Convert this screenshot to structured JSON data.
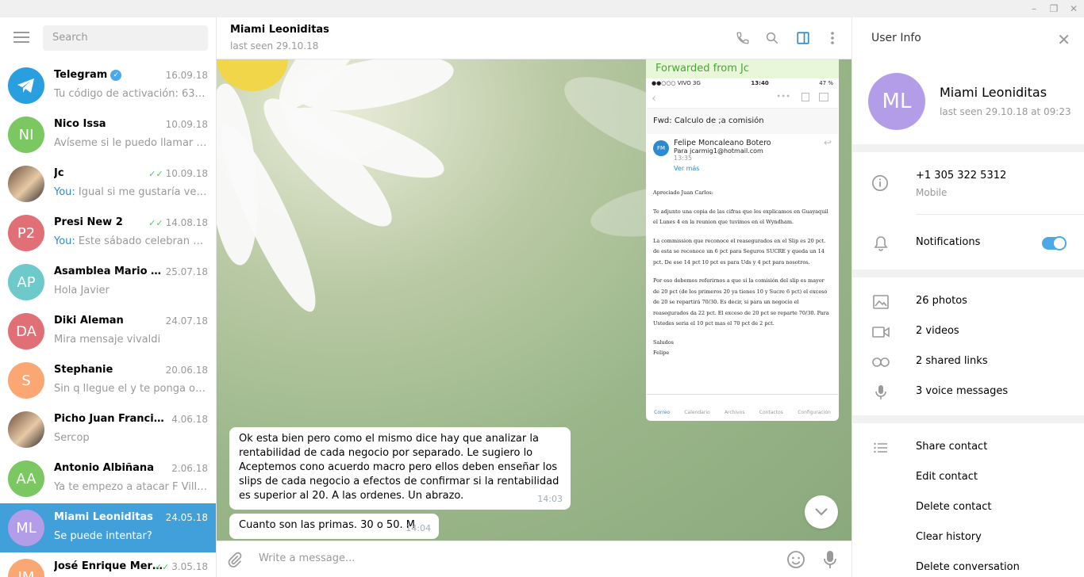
{
  "window": {
    "minimize_icon": "minimize-icon",
    "restore_icon": "restore-icon",
    "close_icon": "close-icon"
  },
  "sidebar": {
    "search_placeholder": "Search",
    "chats": [
      {
        "name": "Telegram",
        "verified": true,
        "date": "16.09.18",
        "preview": "Tu código de activación: 63664 ...",
        "avatar_color": "#2a9fe0",
        "avatar_text": ""
      },
      {
        "name": "Nico Issa",
        "date": "10.09.18",
        "preview": "Avíseme si le puedo llamar por ...",
        "avatar_color": "#7bc862",
        "avatar_text": "NI"
      },
      {
        "name": "Jc",
        "date": "10.09.18",
        "ticks": "✓✓",
        "you": "You:",
        "preview": " Igual si me gustaría verlo s...",
        "avatar_color": "#3a3a3a",
        "avatar_text": ""
      },
      {
        "name": "Presi New 2",
        "date": "14.08.18",
        "ticks": "✓✓",
        "you": "You:",
        "preview": " Este sábado celebran 4 a...",
        "avatar_color": "#e17076",
        "avatar_text": "P2"
      },
      {
        "name": "Asamblea Mario Paz...",
        "date": "25.07.18",
        "preview": "Hola Javier",
        "avatar_color": "#6ec9cb",
        "avatar_text": "AP"
      },
      {
        "name": "Diki Aleman",
        "date": "24.07.18",
        "preview": "Mira mensaje vivaldi",
        "avatar_color": "#e17076",
        "avatar_text": "DA"
      },
      {
        "name": "Stephanie",
        "date": "20.06.18",
        "preview": "Sin q llegue el y te ponga obstá...",
        "avatar_color": "#faa774",
        "avatar_text": "S"
      },
      {
        "name": "Picho Juan Francisco",
        "date": "4.06.18",
        "preview": "Sercop",
        "avatar_color": "#c62828",
        "avatar_text": ""
      },
      {
        "name": "Antonio Albiñana",
        "date": "2.06.18",
        "preview": "Ya te empezo a atacar F Vill con...",
        "avatar_color": "#7bc862",
        "avatar_text": "AA"
      },
      {
        "name": "Miami Leoniditas",
        "date": "24.05.18",
        "preview": "Se puede intentar?",
        "avatar_color": "#b39ce8",
        "avatar_text": "ML",
        "active": true
      },
      {
        "name": "José Enrique Merc...",
        "date": "3.05.18",
        "ticks": "✓✓",
        "preview": "",
        "avatar_color": "#faa774",
        "avatar_text": "JM"
      }
    ]
  },
  "chat": {
    "peer_name": "Miami Leoniditas",
    "peer_status": "last seen 29.10.18",
    "forwarded_label": "Forwarded from Jc",
    "phone": {
      "carrier": "●●○○○ VIVO  3G",
      "time": "13:40",
      "battery": "47 %",
      "subject": "Fwd: Calculo de ;a comisión",
      "fm": "FM",
      "sender": "Felipe Moncaleano Botero",
      "to": "Para jcarmig1@hotmail.com",
      "sent_time": "13:35",
      "ver_mas": "Ver más",
      "body": [
        "Apreciado Juan Carlos:",
        "Te adjunto una copia de las cifras que les explicamos en Guayaquil el Lunes 4 en la reunion que tuvimos en el Wyndham.",
        "La commission que reconoce el reasegurados en el Slip es 20 pct. de esta se reconoce un 6 pct para Seguros SUCRE y queda un 14 pct. De ese 14 pct 10 pct es para Uds y 4 pct para nosotros.",
        "Por eso debemos referirnos a que si la comisión del slip es mayor de 20 pct (de los primeros 20 ya tienes 10 y Sucre 6 pct) el exceso de 20 se repartirá 70/30. Es decir, si para un negocio el reasegurados da 22 pct. El exceso de 20 pct se reparte 70/30. Para Ustedes seria el 10 pct mas el 70 pct de 2 pct.",
        "Saludos",
        "Felipe"
      ],
      "tabs": [
        "Correo",
        "Calendario",
        "Archivos",
        "Contactos",
        "Configuración"
      ]
    },
    "messages": [
      {
        "text": "Ok esta bien pero como el mismo dice hay que analizar la rentabilidad de cada negocio por separado. Le sugiero lo Aceptemos  cono acuerdo macro pero ellos deben enseñar los slips de cada negocio a efectos de confirmar si la rentabilidad es superior al 20.  A las ordenes. Un abrazo.",
        "time": "14:03"
      },
      {
        "text": "Cuanto son las primas. 30 o 50. M",
        "time": "14:04"
      }
    ],
    "composer_placeholder": "Write a message..."
  },
  "info": {
    "title": "User Info",
    "avatar_text": "ML",
    "name": "Miami Leoniditas",
    "last_seen": "last seen 29.10.18 at 09:23",
    "phone": "+1 305 322 5312",
    "phone_label": "Mobile",
    "notifications": "Notifications",
    "notifications_on": true,
    "media": [
      "26 photos",
      "2 videos",
      "2 shared links",
      "3 voice messages"
    ],
    "actions": [
      "Share contact",
      "Edit contact",
      "Delete contact",
      "Clear history",
      "Delete conversation"
    ]
  }
}
